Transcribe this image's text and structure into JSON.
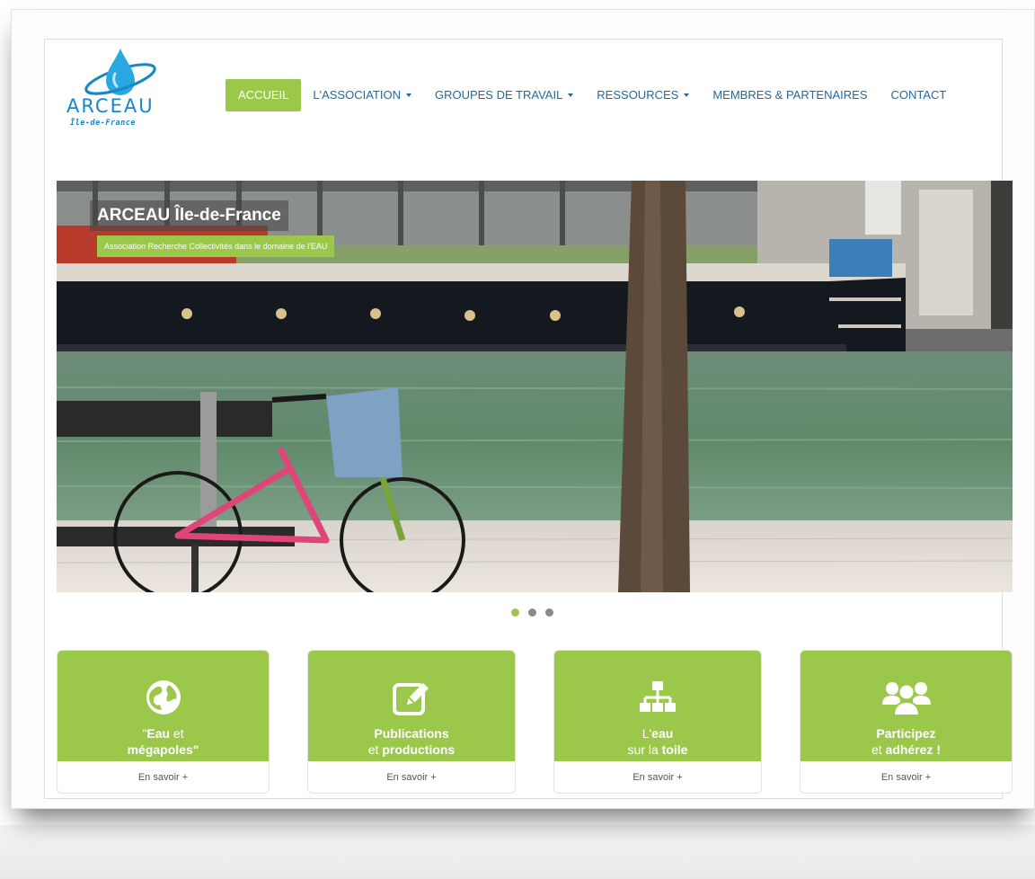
{
  "logo": {
    "wordmark": "ARCEAU",
    "tagline": "Île-de-France"
  },
  "nav": {
    "items": [
      {
        "label": "ACCUEIL",
        "active": true,
        "dropdown": false
      },
      {
        "label": "L'ASSOCIATION",
        "active": false,
        "dropdown": true
      },
      {
        "label": "GROUPES DE TRAVAIL",
        "active": false,
        "dropdown": true
      },
      {
        "label": "RESSOURCES",
        "active": false,
        "dropdown": true
      },
      {
        "label": "MEMBRES & PARTENAIRES",
        "active": false,
        "dropdown": false
      },
      {
        "label": "CONTACT",
        "active": false,
        "dropdown": false
      }
    ]
  },
  "hero": {
    "title": "ARCEAU Île-de-France",
    "subtitle": "Association Recherche Collectivités dans le domaine de l'EAU",
    "slide_count": 3,
    "active_slide": 1
  },
  "cards": [
    {
      "icon": "globe-icon",
      "line1_plain": "\"",
      "line1_bold": "Eau",
      "line1_after": " et",
      "line2_plain": "",
      "line2_bold": "mégapoles",
      "line2_after": "\"",
      "link": "En savoir +"
    },
    {
      "icon": "edit-icon",
      "line1_plain": "",
      "line1_bold": "Publications",
      "line1_after": "",
      "line2_plain": "et ",
      "line2_bold": "productions",
      "line2_after": "",
      "link": "En savoir +"
    },
    {
      "icon": "sitemap-icon",
      "line1_plain": "L'",
      "line1_bold": "eau",
      "line1_after": "",
      "line2_plain": "sur la ",
      "line2_bold": "toile",
      "line2_after": "",
      "link": "En savoir +"
    },
    {
      "icon": "users-icon",
      "line1_plain": "",
      "line1_bold": "Participez",
      "line1_after": "",
      "line2_plain": "et ",
      "line2_bold": "adhérez !",
      "line2_after": "",
      "link": "En savoir +"
    }
  ],
  "colors": {
    "accent_green": "#9bc84a",
    "nav_blue": "#1f6aa1",
    "logo_blue": "#1a86c6"
  }
}
